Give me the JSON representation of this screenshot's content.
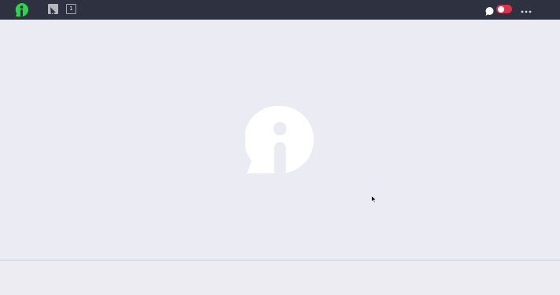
{
  "toolbar": {
    "logo_icon": "app-logo-icon",
    "select_tool_icon": "cursor-arrow-icon",
    "page_count": "1",
    "chat_icon": "chat-bubble-icon",
    "toggle_state": "off",
    "more_icon": "more-horizontal-icon"
  },
  "canvas": {
    "center_icon": "info-logo-icon"
  },
  "colors": {
    "topbar": "#2E3140",
    "canvas": "#EBEBF3",
    "brand_green": "#2BD54E",
    "toggle_red": "#E0314B"
  }
}
